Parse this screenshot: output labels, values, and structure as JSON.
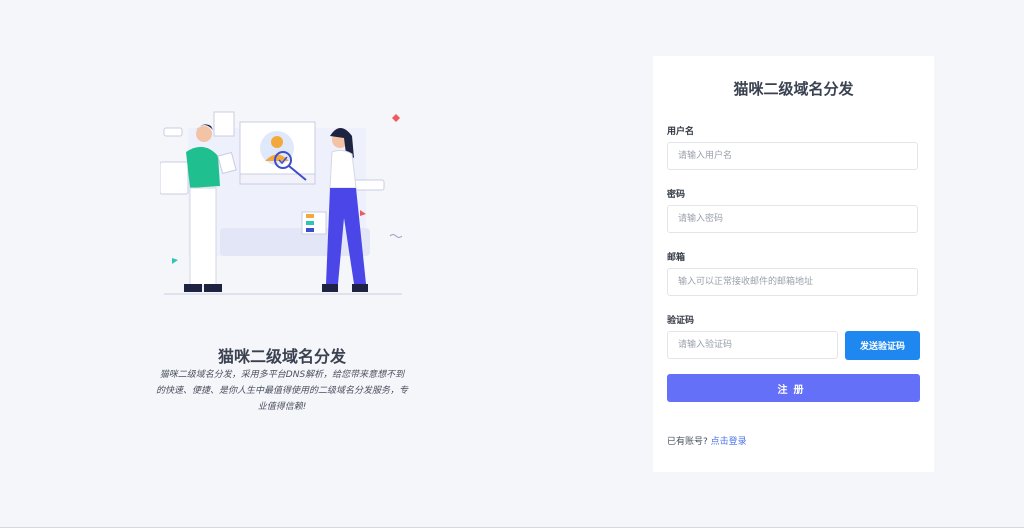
{
  "promo": {
    "title": "猫咪二级域名分发",
    "description": "猫咪二级域名分发，采用多平台DNS解析，给您带来意想不到的快速、便捷、是你人生中最值得使用的二级域名分发服务，专业值得信赖!"
  },
  "form": {
    "title": "猫咪二级域名分发",
    "username": {
      "label": "用户名",
      "placeholder": "请输入用户名",
      "value": ""
    },
    "password": {
      "label": "密码",
      "placeholder": "请输入密码",
      "value": ""
    },
    "email": {
      "label": "邮箱",
      "placeholder": "输入可以正常接收邮件的邮箱地址",
      "value": ""
    },
    "captcha": {
      "label": "验证码",
      "placeholder": "请输入验证码",
      "value": "",
      "send_label": "发送验证码"
    },
    "register_label": "注册",
    "login_prompt": "已有账号?",
    "login_link": "点击登录"
  },
  "colors": {
    "primary": "#6470f7",
    "send_button": "#1e87f0",
    "link": "#4a74e8",
    "background": "#f5f6fa"
  },
  "icons": [
    "people-verification-illustration"
  ]
}
